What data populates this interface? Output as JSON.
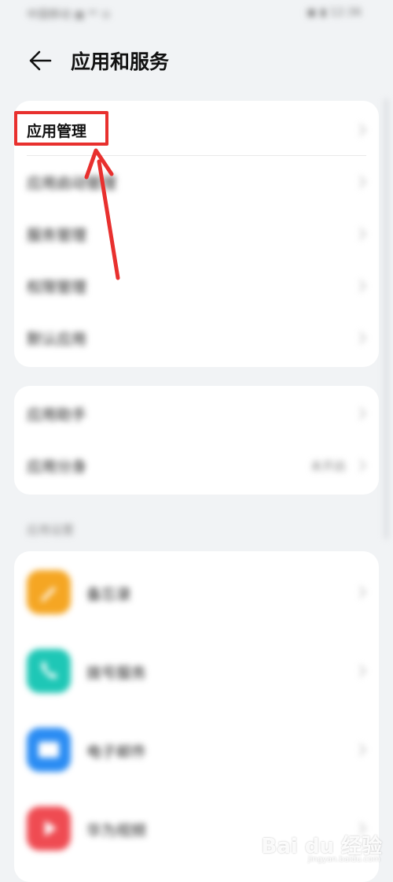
{
  "status_bar": {
    "left": "中国移动 ▦ ⁴ᴳ ⊙",
    "right": "▣ ▮ 12:36"
  },
  "header": {
    "title": "应用和服务"
  },
  "card1": {
    "items": [
      {
        "label": "应用管理"
      },
      {
        "label": "应用启动管理"
      },
      {
        "label": "服务管理"
      },
      {
        "label": "权限管理"
      },
      {
        "label": "默认应用"
      }
    ]
  },
  "card2": {
    "items": [
      {
        "label": "应用助手"
      },
      {
        "label": "应用分身",
        "value": "未开启"
      }
    ]
  },
  "section": {
    "label": "应用设置"
  },
  "apps": [
    {
      "label": "备忘录",
      "color": "#f5a623"
    },
    {
      "label": "拨号服务",
      "color": "#1ec7b6"
    },
    {
      "label": "电子邮件",
      "color": "#2a8cf3"
    },
    {
      "label": "华为视频",
      "color": "#ef4b52"
    }
  ],
  "colors": {
    "annotation": "#e8302e",
    "background": "#f1f3f5"
  },
  "watermark": {
    "text": "Bai du 经验",
    "sub": "jingyan.baidu.com"
  }
}
